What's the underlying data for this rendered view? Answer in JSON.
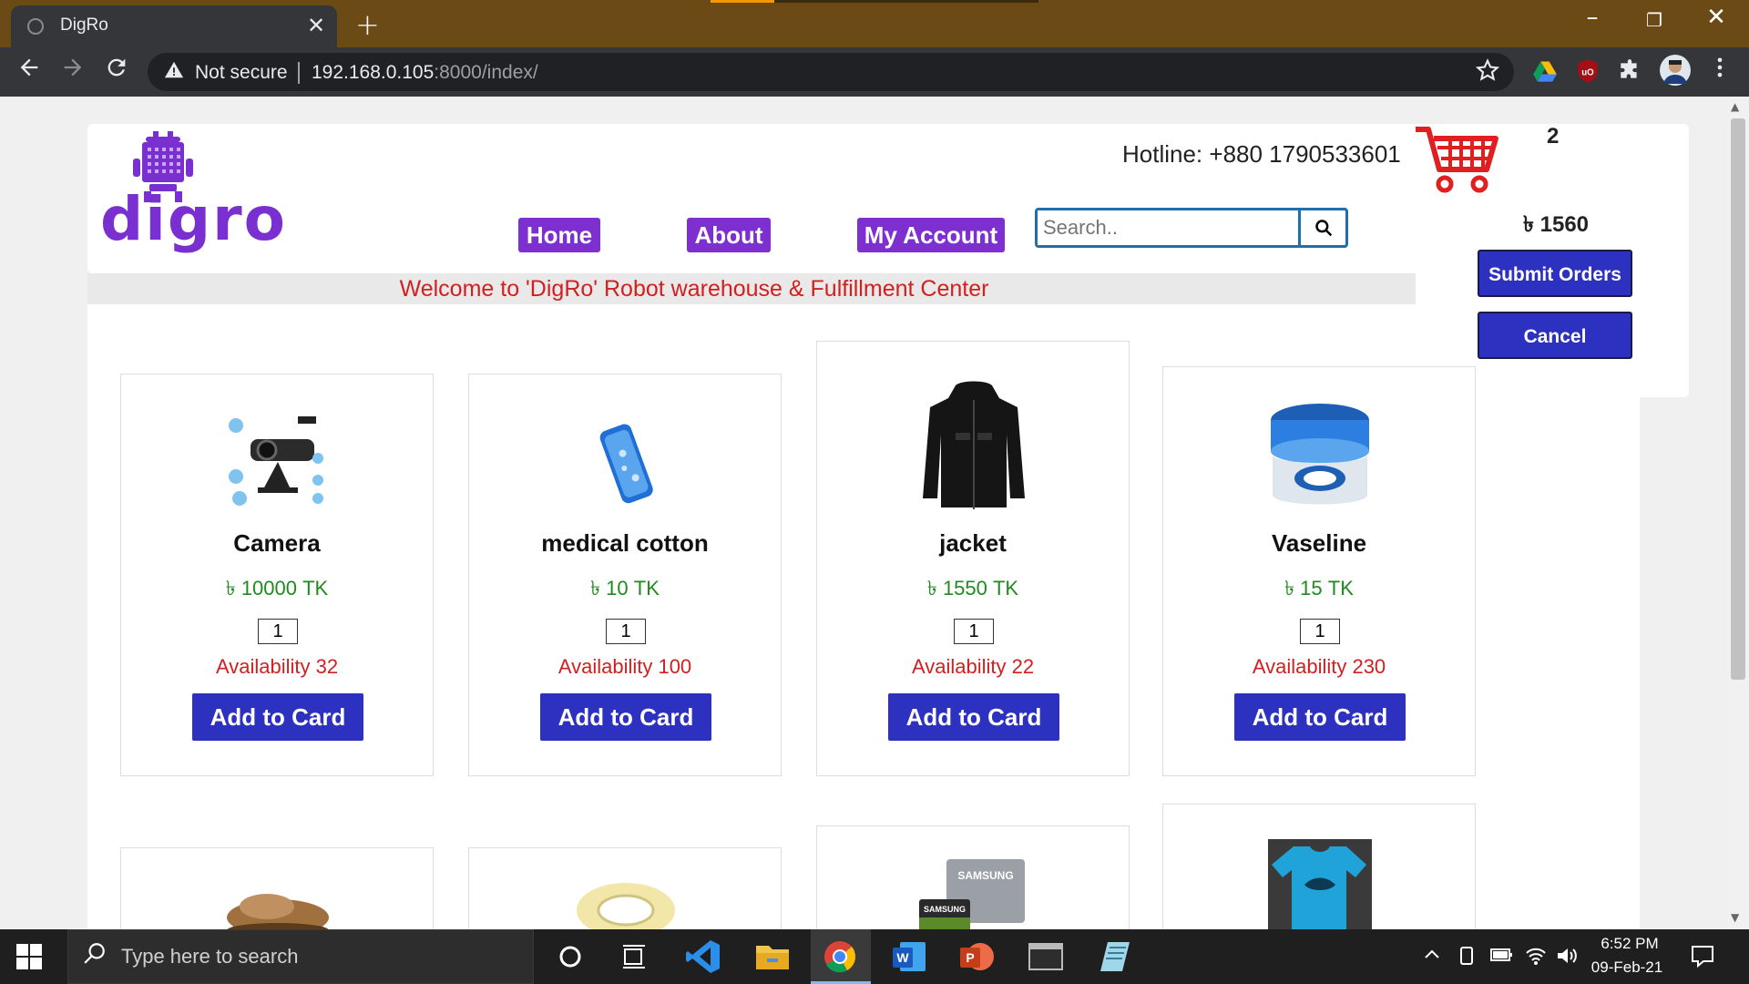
{
  "browser": {
    "tab_title": "DigRo",
    "tab_close": "✕",
    "new_tab": "+",
    "security_label": "Not secure",
    "url_host": "192.168.0.105",
    "url_rest": ":8000/index/",
    "minimize": "–",
    "restore": "❐",
    "close": "✕"
  },
  "site": {
    "logo_text": "digro",
    "hotline": "Hotline: +880 1790533601",
    "cart_count": "2",
    "cart_total": "৳ 1560",
    "nav": [
      "Home",
      "About",
      "My Account"
    ],
    "search_placeholder": "Search..",
    "welcome": "Welcome to 'DigRo' Robot warehouse & Fulfillment Center",
    "submit_orders": "Submit Orders",
    "cancel": "Cancel"
  },
  "products": [
    {
      "name": "Camera",
      "price": "৳ 10000 TK",
      "qty": "1",
      "availability": "Availability 32",
      "button": "Add to Card"
    },
    {
      "name": "medical cotton",
      "price": "৳ 10 TK",
      "qty": "1",
      "availability": "Availability 100",
      "button": "Add to Card"
    },
    {
      "name": "jacket",
      "price": "৳ 1550 TK",
      "qty": "1",
      "availability": "Availability 22",
      "button": "Add to Card"
    },
    {
      "name": "Vaseline",
      "price": "৳ 15 TK",
      "qty": "1",
      "availability": "Availability 230",
      "button": "Add to Card"
    }
  ],
  "product_image_labels": {
    "memory_card_brand": "SAMSUNG"
  },
  "taskbar": {
    "search_placeholder": "Type here to search",
    "time": "6:52 PM",
    "date": "09-Feb-21"
  },
  "colors": {
    "brand_purple": "#7d2fd0",
    "button_blue": "#2d31c0",
    "price_green": "#1f8b1f",
    "alert_red": "#d21f1f",
    "cart_red": "#e02020"
  }
}
